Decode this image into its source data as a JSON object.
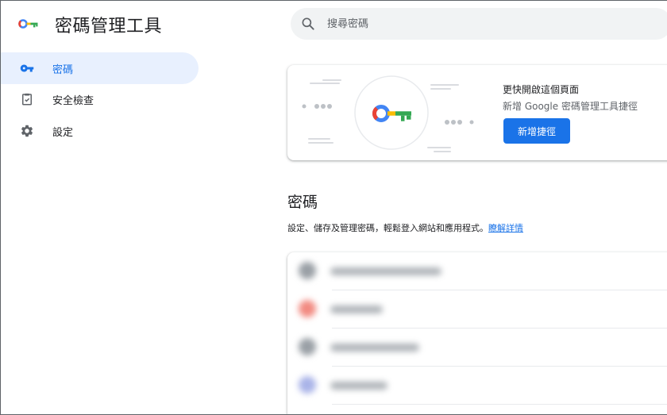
{
  "app": {
    "title": "密碼管理工具",
    "logo_icon": "key-logo-icon"
  },
  "search": {
    "placeholder": "搜尋密碼",
    "icon": "search-icon"
  },
  "sidebar": {
    "items": [
      {
        "label": "密碼",
        "icon": "key-icon",
        "active": true
      },
      {
        "label": "安全檢查",
        "icon": "clipboard-check-icon",
        "active": false
      },
      {
        "label": "設定",
        "icon": "gear-icon",
        "active": false
      }
    ]
  },
  "promo": {
    "title": "更快開啟這個頁面",
    "description": "新增 Google 密碼管理工具捷徑",
    "button_label": "新增捷徑"
  },
  "main": {
    "section_title": "密碼",
    "description": "設定、儲存及管理密碼，輕鬆登入網站和應用程式。",
    "learn_more": "瞭解詳情"
  },
  "password_list": {
    "rows": [
      {
        "favicon_color": "#9aa0a6",
        "blurred": true
      },
      {
        "favicon_color": "#f28b82",
        "blurred": true
      },
      {
        "favicon_color": "#9aa0a6",
        "blurred": true
      },
      {
        "favicon_color": "#aab4e8",
        "blurred": true
      }
    ]
  },
  "colors": {
    "accent": "#1a73e8",
    "active_nav_bg": "#e8f0fe",
    "search_bg": "#f1f3f4",
    "logo_blue": "#4285f4",
    "logo_red": "#ea4335",
    "logo_yellow": "#fbbc04",
    "logo_green": "#34a853"
  }
}
